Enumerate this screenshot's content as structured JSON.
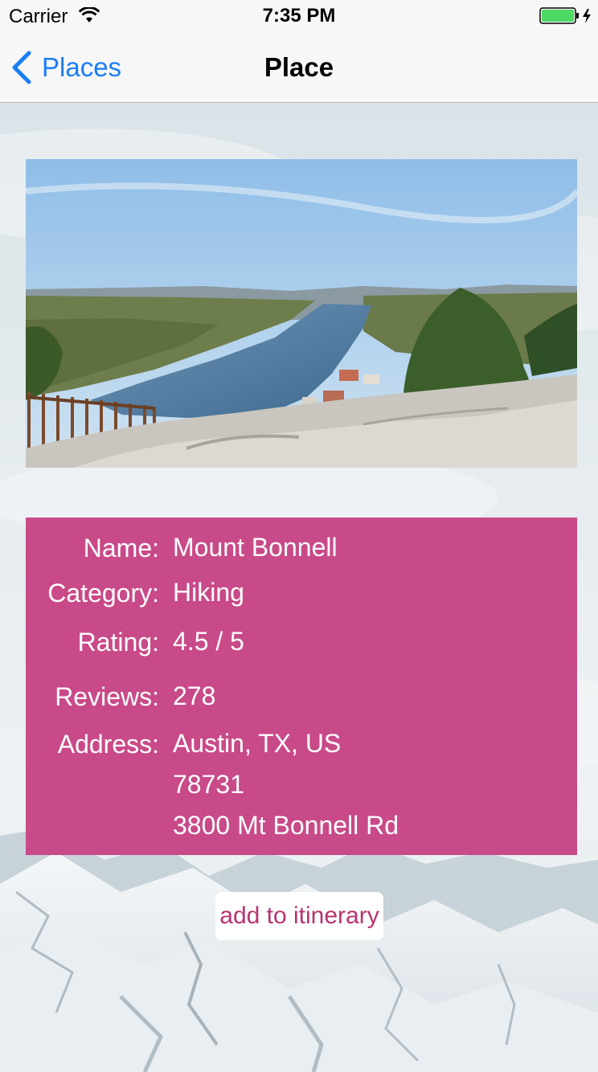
{
  "status_bar": {
    "carrier": "Carrier",
    "time": "7:35 PM",
    "battery_color": "#4cd964"
  },
  "nav": {
    "back_label": "Places",
    "title": "Place",
    "accent_color": "#1a7ef5"
  },
  "photo": {
    "subject": "aerial-river-valley"
  },
  "details": {
    "card_color": "#c94a88",
    "name": {
      "label": "Name:",
      "value": "Mount Bonnell"
    },
    "category": {
      "label": "Category:",
      "value": "Hiking"
    },
    "rating": {
      "label": "Rating:",
      "value": "4.5 / 5"
    },
    "reviews": {
      "label": "Reviews:",
      "value": "278"
    },
    "address": {
      "label": "Address:",
      "line1": "Austin, TX, US",
      "line2": "78731",
      "line3": "3800 Mt Bonnell Rd"
    }
  },
  "actions": {
    "add_to_itinerary": "add to itinerary"
  }
}
